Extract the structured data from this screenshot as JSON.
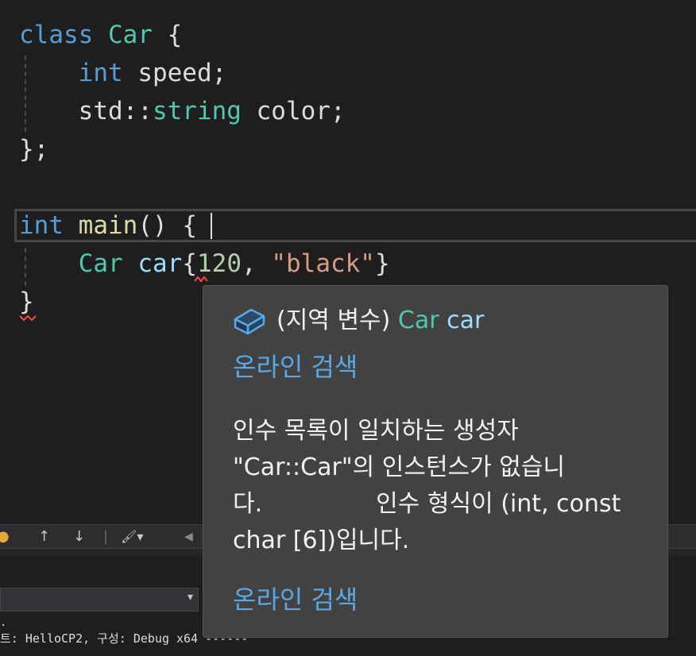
{
  "code": {
    "l1": {
      "kw": "class",
      "type": "Car",
      "rest": " {"
    },
    "l2": {
      "kw": "int",
      "rest": " speed;"
    },
    "l3": {
      "ns": "std::",
      "type": "string",
      "rest": " color;"
    },
    "l4": {
      "text": "};"
    },
    "l6": {
      "kw": "int",
      "fn": "main",
      "rest": "() {"
    },
    "l7": {
      "type": "Car",
      "var": "car",
      "open": "{",
      "num": "120",
      "comma": ", ",
      "str": "\"black\"",
      "close": "}"
    },
    "l8": {
      "text": "}"
    }
  },
  "toolbar": {
    "up_arrow": "↑",
    "down_arrow": "↓",
    "separator": "|",
    "brush": "🖌▾",
    "left_arrow": "◀"
  },
  "panel": {
    "output_line": "트: HelloCP2, 구성: Debug x64 ------",
    "dot": "."
  },
  "tooltip": {
    "kind": "(지역 변수) ",
    "type_name": "Car",
    "var_name": "car",
    "search_link_1": "온라인 검색",
    "message": "인수 목록이 일치하는 생성자 \"Car::Car\"의 인스턴스가 없습니다.               인수 형식이 (int, const char [6])입니다.",
    "search_link_2": "온라인 검색",
    "colors": {
      "type": "#4ec9b0",
      "var": "#9cdcfe",
      "link": "#5ba8e6"
    }
  }
}
